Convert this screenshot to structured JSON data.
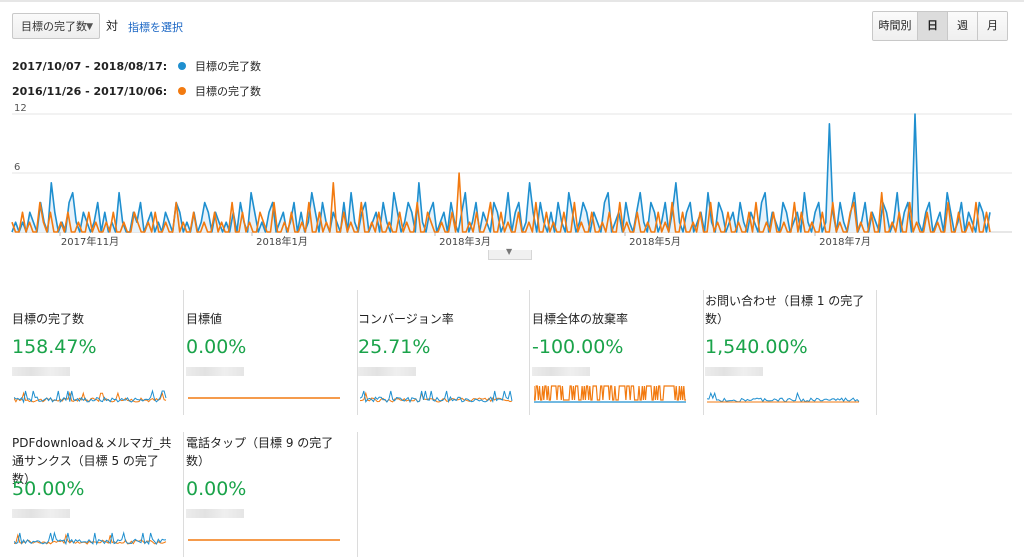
{
  "toolbar": {
    "metric_select": "目標の完了数",
    "vs_label": "対",
    "choose_metric_link": "指標を選択",
    "granularity": [
      "時間別",
      "日",
      "週",
      "月"
    ],
    "active_granularity": "日"
  },
  "legend": [
    {
      "range": "2017/10/07 - 2018/08/17:",
      "metric": "目標の完了数",
      "color": "#1f8fcf"
    },
    {
      "range": "2016/11/26 - 2017/10/06:",
      "metric": "目標の完了数",
      "color": "#f27a10"
    }
  ],
  "chart_data": {
    "type": "line",
    "ylim": [
      0,
      12
    ],
    "y_ticks": [
      "12",
      "6"
    ],
    "x_ticks": [
      "2017年11月",
      "2018年1月",
      "2018年3月",
      "2018年5月",
      "2018年7月"
    ],
    "series": [
      {
        "name": "2017/10/07 - 2018/08/17",
        "color": "#1f8fcf",
        "values": [
          0,
          1,
          0,
          1,
          0,
          2,
          1,
          0,
          3,
          1,
          0,
          5,
          2,
          0,
          1,
          0,
          3,
          4,
          1,
          0,
          2,
          1,
          0,
          1,
          3,
          0,
          2,
          0,
          1,
          0,
          4,
          1,
          0,
          0,
          2,
          1,
          3,
          0,
          1,
          2,
          0,
          1,
          0,
          2,
          1,
          0,
          3,
          2,
          0,
          1,
          0,
          2,
          0,
          1,
          3,
          2,
          0,
          2,
          1,
          0,
          1,
          0,
          2,
          0,
          3,
          1,
          0,
          4,
          2,
          0,
          1,
          0,
          2,
          3,
          0,
          1,
          2,
          0,
          1,
          3,
          0,
          2,
          0,
          1,
          4,
          2,
          0,
          3,
          1,
          0,
          2,
          1,
          0,
          3,
          0,
          4,
          1,
          0,
          2,
          3,
          0,
          1,
          2,
          0,
          3,
          1,
          0,
          4,
          2,
          0,
          1,
          3,
          2,
          0,
          5,
          1,
          0,
          2,
          3,
          0,
          1,
          2,
          0,
          3,
          1,
          0,
          2,
          4,
          0,
          1,
          3,
          0,
          2,
          1,
          0,
          3,
          2,
          0,
          1,
          4,
          0,
          2,
          3,
          0,
          1,
          5,
          2,
          0,
          3,
          1,
          0,
          2,
          0,
          3,
          1,
          0,
          4,
          2,
          0,
          1,
          3,
          2,
          0,
          2,
          1,
          0,
          3,
          4,
          0,
          1,
          2,
          0,
          3,
          1,
          0,
          2,
          4,
          1,
          0,
          3,
          2,
          0,
          1,
          3,
          0,
          2,
          5,
          1,
          0,
          2,
          3,
          0,
          1,
          2,
          0,
          4,
          1,
          0,
          3,
          2,
          0,
          1,
          2,
          0,
          3,
          1,
          0,
          2,
          1,
          0,
          3,
          4,
          0,
          2,
          1,
          0,
          3,
          2,
          0,
          1,
          2,
          0,
          4,
          1,
          0,
          2,
          3,
          0,
          1,
          11,
          2,
          0,
          3,
          1,
          0,
          2,
          4,
          0,
          1,
          3,
          0,
          2,
          1,
          0,
          3,
          2,
          0,
          1,
          4,
          0,
          2,
          3,
          0,
          12,
          1,
          0,
          2,
          3,
          0,
          1,
          2,
          0,
          4,
          2,
          0,
          1,
          3,
          0,
          2,
          1,
          0,
          3,
          2,
          0,
          2
        ]
      },
      {
        "name": "2016/11/26 - 2017/10/06",
        "color": "#f27a10",
        "values": [
          1,
          0,
          0,
          2,
          0,
          1,
          0,
          0,
          3,
          1,
          0,
          2,
          0,
          0,
          1,
          0,
          2,
          0,
          0,
          1,
          0,
          0,
          2,
          0,
          1,
          0,
          0,
          1,
          0,
          2,
          0,
          0,
          1,
          0,
          0,
          2,
          1,
          0,
          0,
          1,
          0,
          2,
          0,
          0,
          1,
          0,
          0,
          3,
          0,
          1,
          0,
          0,
          2,
          0,
          0,
          1,
          0,
          0,
          2,
          0,
          1,
          0,
          0,
          3,
          0,
          0,
          2,
          0,
          1,
          0,
          0,
          2,
          1,
          0,
          0,
          3,
          0,
          0,
          1,
          0,
          2,
          0,
          0,
          1,
          0,
          3,
          0,
          0,
          2,
          0,
          1,
          0,
          5,
          0,
          0,
          2,
          0,
          1,
          0,
          0,
          3,
          0,
          0,
          1,
          0,
          2,
          0,
          0,
          1,
          0,
          0,
          2,
          0,
          1,
          0,
          0,
          3,
          0,
          0,
          2,
          1,
          0,
          0,
          1,
          0,
          0,
          2,
          0,
          6,
          0,
          0,
          1,
          0,
          2,
          0,
          0,
          1,
          3,
          0,
          0,
          2,
          0,
          1,
          0,
          0,
          2,
          0,
          0,
          1,
          0,
          3,
          0,
          0,
          2,
          0,
          1,
          0,
          0,
          2,
          0,
          0,
          3,
          0,
          1,
          0,
          0,
          2,
          0,
          0,
          1,
          0,
          2,
          0,
          0,
          3,
          0,
          1,
          0,
          0,
          2,
          0,
          0,
          1,
          0,
          0,
          2,
          0,
          1,
          0,
          3,
          0,
          0,
          2,
          0,
          0,
          1,
          0,
          2,
          0,
          0,
          3,
          0,
          1,
          0,
          0,
          2,
          0,
          0,
          1,
          0,
          0,
          2,
          0,
          3,
          0,
          0,
          1,
          0,
          2,
          0,
          0,
          1,
          0,
          0,
          3,
          0,
          2,
          0,
          0,
          1,
          0,
          0,
          2,
          0,
          0,
          3,
          0,
          1,
          0,
          0,
          2,
          3,
          0,
          1,
          0,
          0,
          2,
          0,
          0,
          4,
          0,
          0,
          1,
          0,
          2,
          0,
          0,
          3,
          0,
          1,
          0,
          0,
          2,
          0,
          0,
          1,
          0,
          0,
          3,
          0,
          0,
          2,
          0,
          0,
          1,
          0,
          3,
          0,
          0,
          2,
          0
        ]
      }
    ]
  },
  "cards": [
    {
      "title": "目標の完了数",
      "value": "158.47%",
      "spark": "mixed"
    },
    {
      "title": "目標値",
      "value": "0.00%",
      "spark": "flat"
    },
    {
      "title": "コンバージョン率",
      "value": "25.71%",
      "spark": "mixed"
    },
    {
      "title": "目標全体の放棄率",
      "value": "-100.00%",
      "spark": "abandon"
    },
    {
      "title": "お問い合わせ（目標 1 の完了数）",
      "value": "1,540.00%",
      "spark": "blue"
    },
    {
      "title": "PDFdownload＆メルマガ_共通サンクス（目標 5 の完了数）",
      "value": "50.00%",
      "spark": "mixed"
    },
    {
      "title": "電話タップ（目標 9 の完了数）",
      "value": "0.00%",
      "spark": "flat"
    }
  ]
}
